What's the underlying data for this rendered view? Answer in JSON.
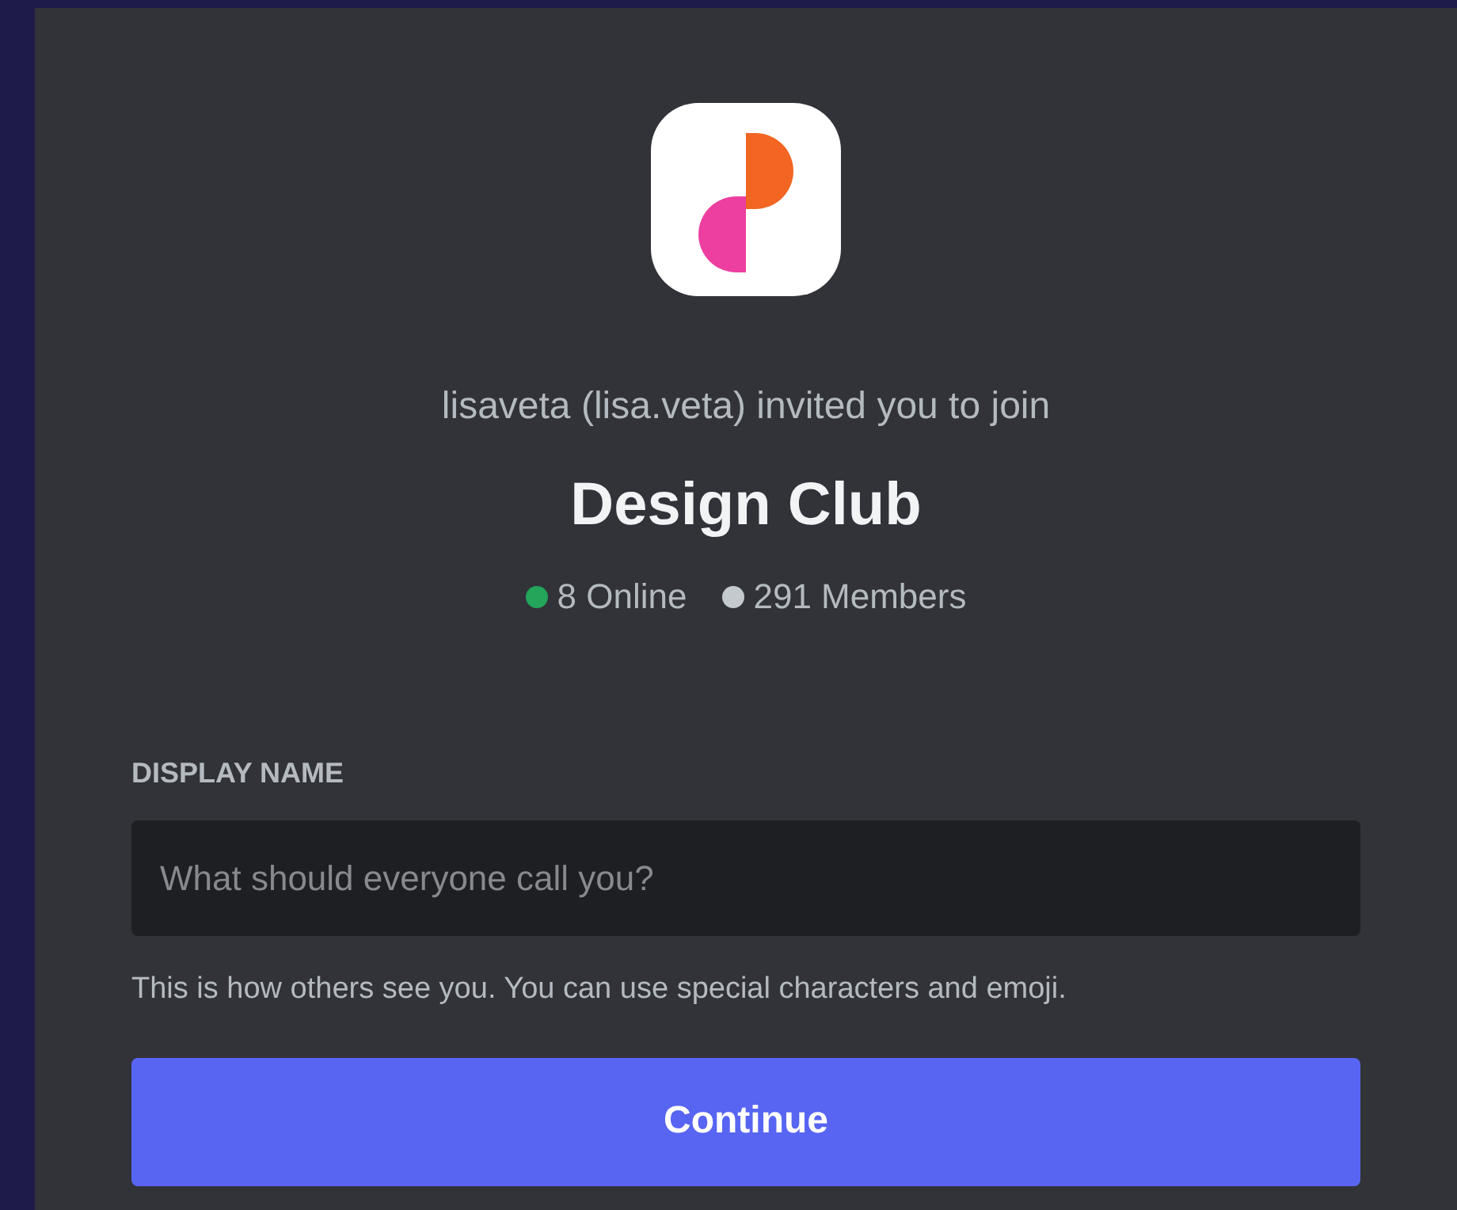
{
  "invite": {
    "text": "lisaveta (lisa.veta) invited you to join"
  },
  "server": {
    "name": "Design Club"
  },
  "stats": [
    {
      "label": "8 Online",
      "color": "#23a55a"
    },
    {
      "label": "291 Members",
      "color": "#c4c9ce"
    }
  ],
  "display_name": {
    "label": "DISPLAY NAME",
    "placeholder": "What should everyone call you?",
    "help": "This is how others see you. You can use special characters and emoji."
  },
  "buttons": [
    {
      "label": "Continue"
    }
  ]
}
